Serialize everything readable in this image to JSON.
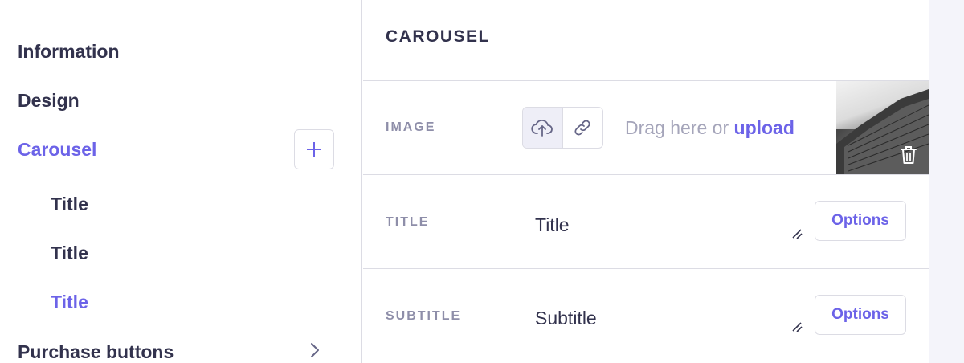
{
  "sidebar": {
    "items": [
      {
        "label": "Information"
      },
      {
        "label": "Design"
      },
      {
        "label": "Carousel"
      },
      {
        "label": "Purchase buttons"
      }
    ],
    "sub_items": [
      {
        "label": "Title"
      },
      {
        "label": "Title"
      },
      {
        "label": "Title"
      }
    ],
    "add_icon": "plus-icon",
    "chevron_icon": "chevron-right-icon"
  },
  "main": {
    "title": "CAROUSEL",
    "image_field": {
      "label": "IMAGE",
      "upload_icon": "cloud-upload-icon",
      "link_icon": "link-icon",
      "drag_text": "Drag here or",
      "upload_link": "upload",
      "delete_icon": "trash-icon"
    },
    "title_field": {
      "label": "TITLE",
      "value": "Title",
      "options_label": "Options"
    },
    "subtitle_field": {
      "label": "SUBTITLE",
      "value": "Subtitle",
      "options_label": "Options"
    }
  },
  "colors": {
    "accent": "#6c63e8",
    "text": "#32324d",
    "muted": "#8e8ea9",
    "border": "#dcdce4"
  }
}
